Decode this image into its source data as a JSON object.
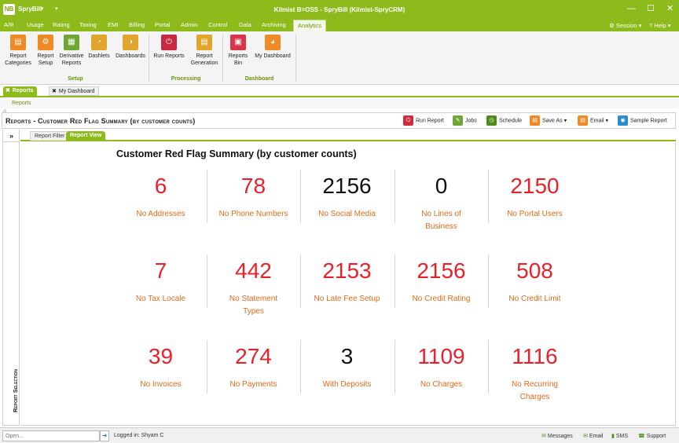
{
  "titlebar": {
    "app_logo": "NB",
    "app_name": "SpryBill",
    "window_title": "Kilmist B=OSS - SpryBill (Kilmist-SpryCRM)",
    "minimize": "—",
    "maximize": "☐",
    "close": "✕"
  },
  "menu": {
    "tabs": [
      "A/R",
      "Usage",
      "Rating",
      "Taxing",
      "EMI",
      "Billing",
      "Portal",
      "Admin",
      "Control",
      "Data",
      "Archiving",
      "Analytics"
    ],
    "active": "Analytics",
    "session": "Session",
    "help": "Help"
  },
  "ribbon": {
    "buttons": [
      {
        "label": "Report Categories",
        "icon": "report-categories-icon"
      },
      {
        "label": "Report Setup",
        "icon": "report-setup-icon"
      },
      {
        "label": "Derivative Reports",
        "icon": "derivative-reports-icon"
      },
      {
        "label": "Dashlets",
        "icon": "dashlets-icon"
      },
      {
        "label": "Dashboards",
        "icon": "dashboards-icon"
      },
      {
        "label": "Run Reports",
        "icon": "run-reports-icon"
      },
      {
        "label": "Report Generation",
        "icon": "report-generation-icon"
      },
      {
        "label": "Reports Bin",
        "icon": "reports-bin-icon"
      },
      {
        "label": "My Dashboard",
        "icon": "my-dashboard-icon"
      }
    ],
    "groups": [
      "Setup",
      "Processing",
      "Dashboard"
    ]
  },
  "doc_tabs": {
    "reports": "Reports",
    "my_dashboard": "My Dashboard"
  },
  "breadcrumb": "Reports",
  "page": {
    "title": "Reports - Customer Red Flag Summary (by customer counts)",
    "toolbar": {
      "run_report": "Run Report",
      "jobs": "Jobs",
      "schedule": "Schedule",
      "save_as": "Save As",
      "email": "Email",
      "sample_report": "Sample Report"
    }
  },
  "side_panel": {
    "expand": "»",
    "label": "Report Selection"
  },
  "sub_tabs": {
    "filter": "Report Filter",
    "view": "Report View"
  },
  "report": {
    "title": "Customer Red Flag Summary (by customer counts)",
    "metrics": [
      {
        "value": "6",
        "label": "No Addresses",
        "color": "#e8212b"
      },
      {
        "value": "78",
        "label": "No Phone Numbers",
        "color": "#e8212b"
      },
      {
        "value": "2156",
        "label": "No Social Media",
        "color": "#111111"
      },
      {
        "value": "0",
        "label": "No Lines of Business",
        "color": "#111111"
      },
      {
        "value": "2150",
        "label": "No Portal Users",
        "color": "#e8212b"
      },
      {
        "value": "7",
        "label": "No Tax Locale",
        "color": "#e8212b"
      },
      {
        "value": "442",
        "label": "No Statement Types",
        "color": "#e8212b"
      },
      {
        "value": "2153",
        "label": "No Late Fee Setup",
        "color": "#e8212b"
      },
      {
        "value": "2156",
        "label": "No Credit Rating",
        "color": "#e8212b"
      },
      {
        "value": "508",
        "label": "No Credit Limit",
        "color": "#e8212b"
      },
      {
        "value": "39",
        "label": "No Invoices",
        "color": "#e8212b"
      },
      {
        "value": "274",
        "label": "No Payments",
        "color": "#e8212b"
      },
      {
        "value": "3",
        "label": "With Deposits",
        "color": "#111111"
      },
      {
        "value": "1109",
        "label": "No Charges",
        "color": "#e8212b"
      },
      {
        "value": "1116",
        "label": "No Recurring Charges",
        "color": "#e8212b"
      }
    ]
  },
  "status": {
    "open_placeholder": "Open...",
    "logged_in": "Logged in:  Shyam C",
    "messages": "Messages",
    "email": "Email",
    "sms": "SMS",
    "support": "Support"
  },
  "colors": {
    "brand": "#8dbb1c",
    "alert_value": "#e8212b",
    "label": "#e26a19"
  }
}
